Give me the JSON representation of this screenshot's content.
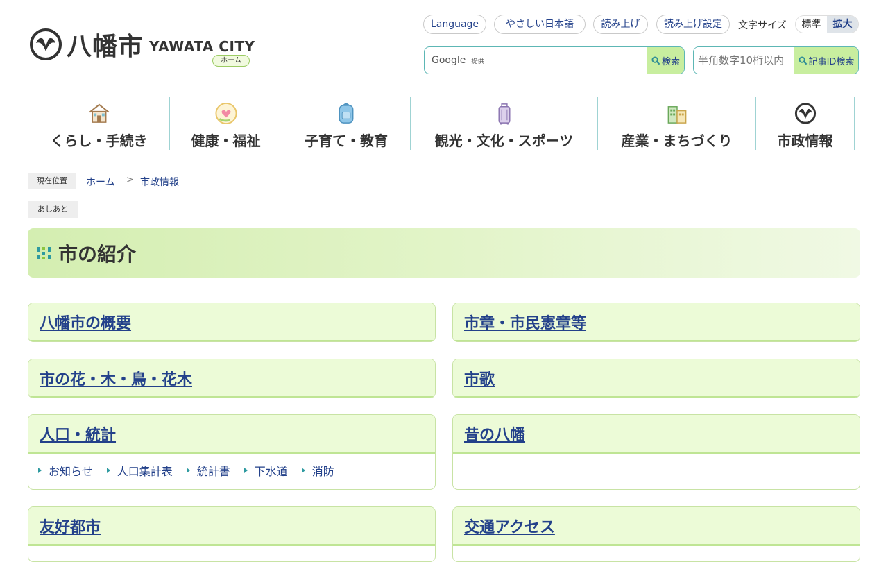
{
  "header": {
    "logo_kanji": "八幡市",
    "logo_en": "YAWATA CITY",
    "home_pill": "ホーム",
    "utility": {
      "language": "Language",
      "easy_japanese": "やさしい日本語",
      "read_aloud": "読み上げ",
      "read_aloud_settings": "読み上げ設定",
      "font_size_label": "文字サイズ",
      "font_standard": "標準",
      "font_large": "拡大"
    },
    "search": {
      "google_label": "Google",
      "provided_label": "提供",
      "button": "検索"
    },
    "id_search": {
      "placeholder": "半角数字10桁以内",
      "button": "記事ID検索"
    }
  },
  "nav": {
    "items": [
      {
        "label": "くらし・手続き",
        "icon": "house-icon"
      },
      {
        "label": "健康・福祉",
        "icon": "heart-hand-icon"
      },
      {
        "label": "子育て・教育",
        "icon": "school-backpack-icon"
      },
      {
        "label": "観光・文化・スポーツ",
        "icon": "suitcase-icon"
      },
      {
        "label": "産業・まちづくり",
        "icon": "buildings-icon"
      },
      {
        "label": "市政情報",
        "icon": "city-emblem-icon"
      }
    ]
  },
  "breadcrumb": {
    "tag": "現在位置",
    "home": "ホーム",
    "separator": ">",
    "current": "市政情報"
  },
  "ashiato": "あしあと",
  "page_title": "市の紹介",
  "cards": [
    {
      "title": "八幡市の概要",
      "links": []
    },
    {
      "title": "市章・市民憲章等",
      "links": []
    },
    {
      "title": "市の花・木・鳥・花木",
      "links": []
    },
    {
      "title": "市歌",
      "links": []
    },
    {
      "title": "人口・統計",
      "links": [
        "お知らせ",
        "人口集計表",
        "統計書",
        "下水道",
        "消防"
      ]
    },
    {
      "title": "昔の八幡",
      "links": []
    },
    {
      "title": "友好都市",
      "links": []
    },
    {
      "title": "交通アクセス",
      "links": []
    }
  ],
  "colors": {
    "link": "#23418a",
    "accent_green": "#c8ee9f",
    "teal_border": "#5db7b5",
    "card_head": "#ecfbd7"
  }
}
